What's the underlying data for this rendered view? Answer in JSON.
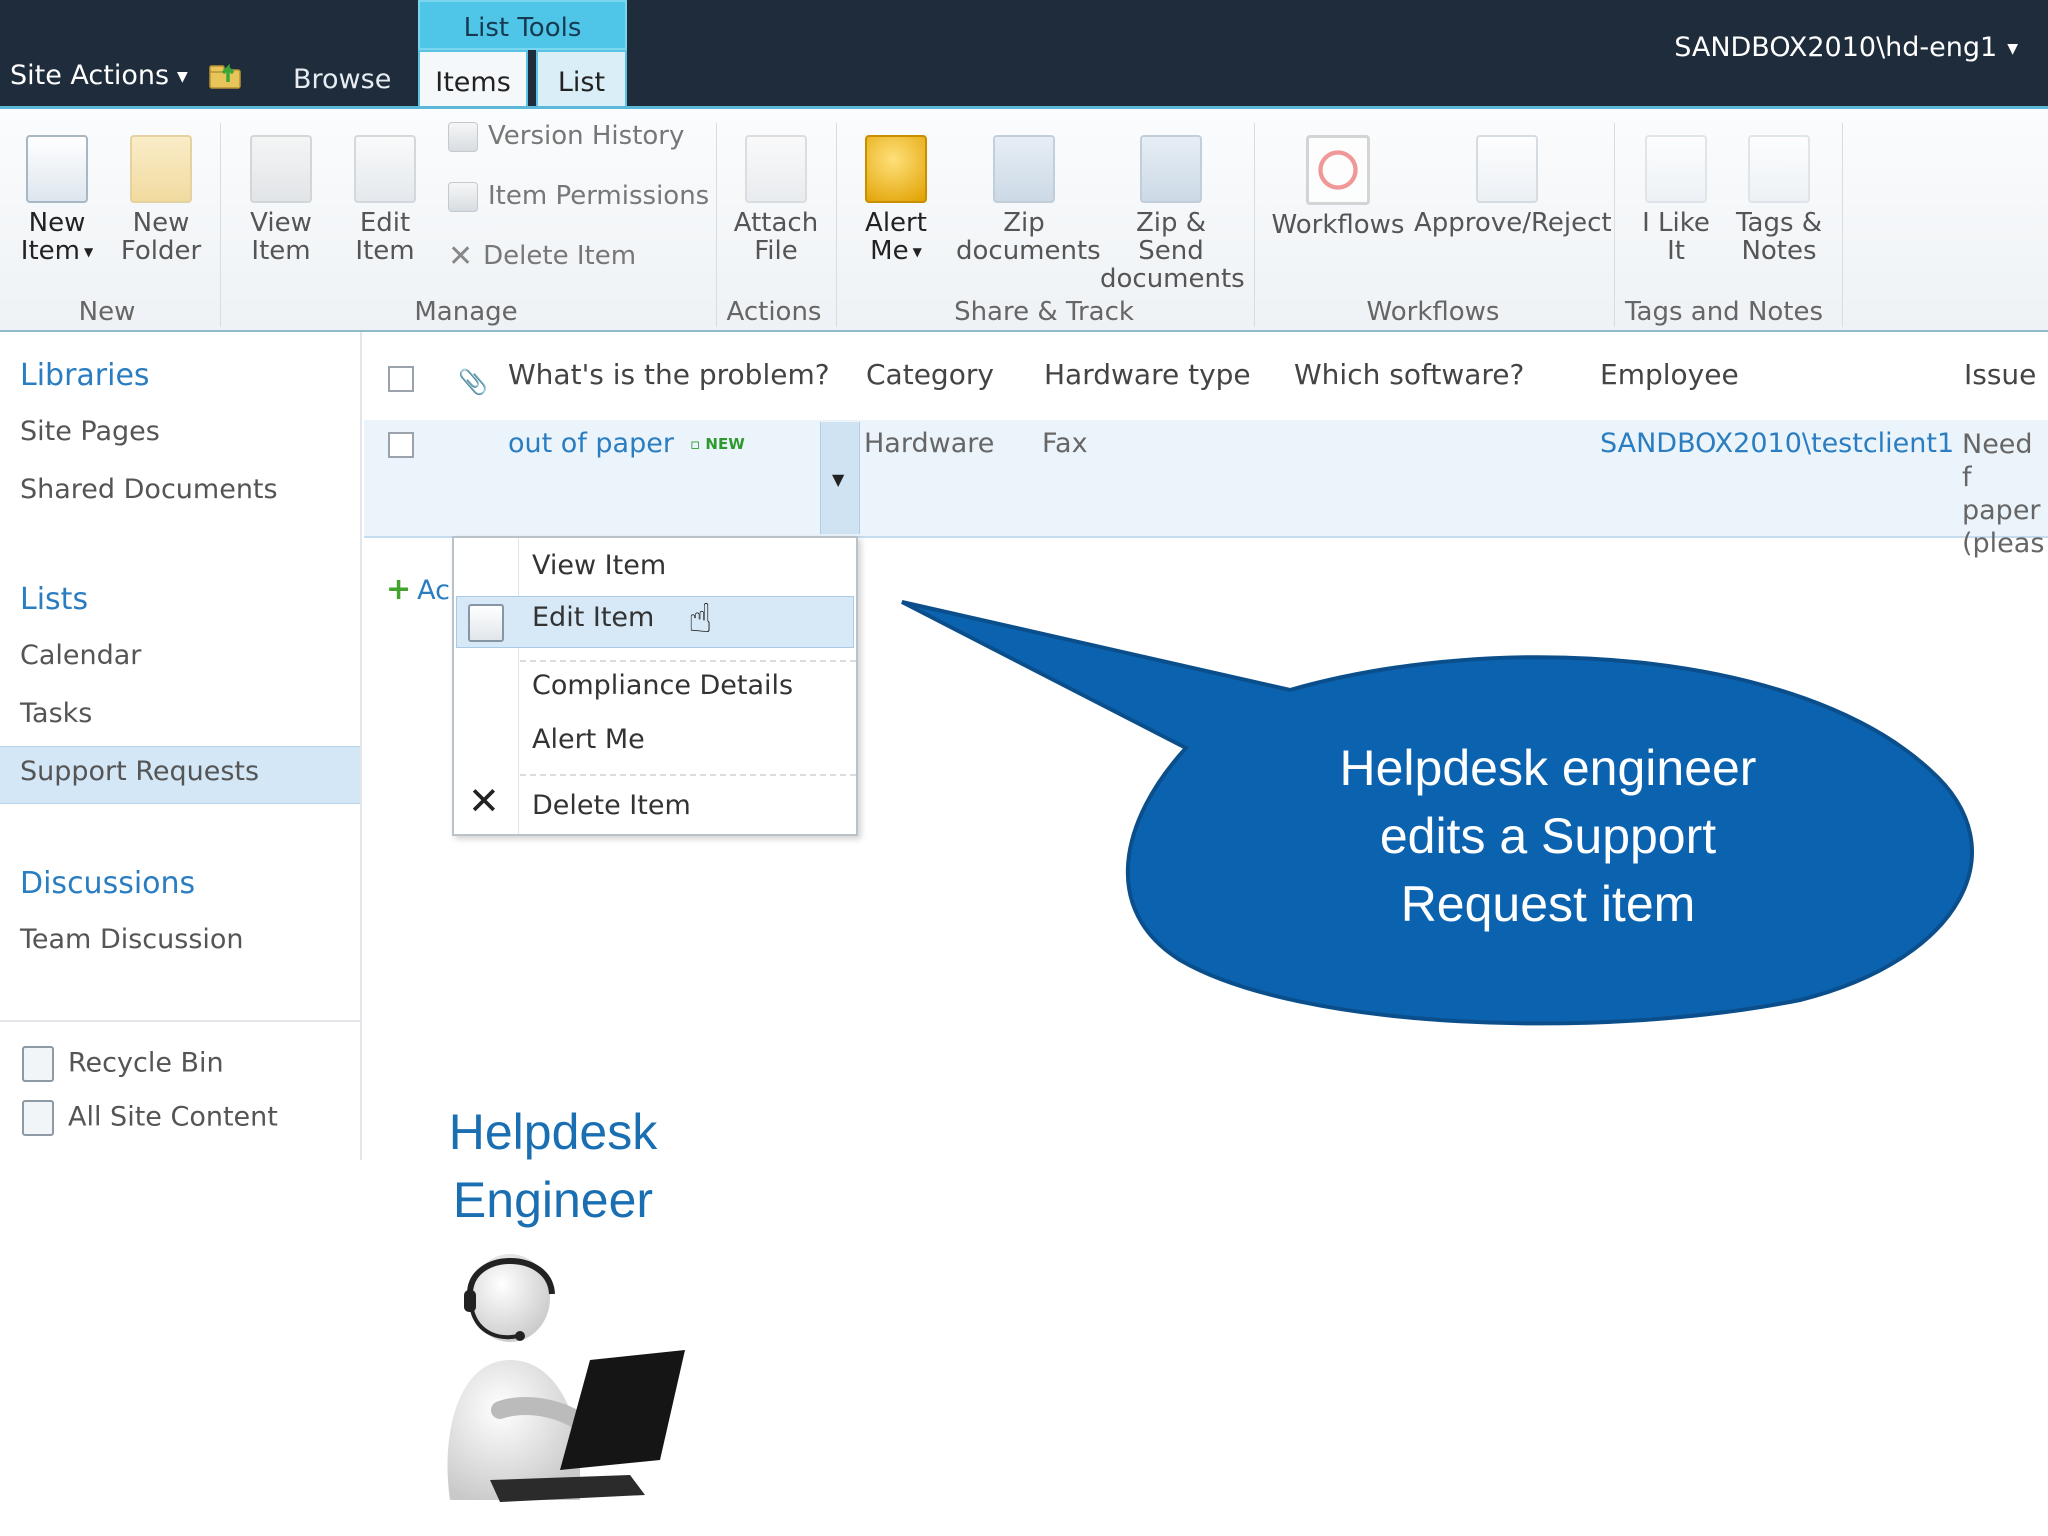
{
  "header": {
    "site_actions": "Site Actions",
    "tab_browse": "Browse",
    "list_tools": "List Tools",
    "tab_items": "Items",
    "tab_list": "List",
    "user": "SANDBOX2010\\hd-eng1"
  },
  "ribbon": {
    "new_item": [
      "New",
      "Item"
    ],
    "new_folder": [
      "New",
      "Folder"
    ],
    "view_item": [
      "View",
      "Item"
    ],
    "edit_item": [
      "Edit",
      "Item"
    ],
    "version_history": "Version History",
    "item_permissions": "Item Permissions",
    "delete_item": "Delete Item",
    "attach_file": [
      "Attach",
      "File"
    ],
    "alert_me": [
      "Alert",
      "Me"
    ],
    "zip_documents": [
      "Zip",
      "documents"
    ],
    "zip_send": [
      "Zip & Send",
      "documents"
    ],
    "workflows": "Workflows",
    "approve_reject": "Approve/Reject",
    "i_like_it": [
      "I Like",
      "It"
    ],
    "tags_notes": [
      "Tags &",
      "Notes"
    ],
    "groups": {
      "new": "New",
      "manage": "Manage",
      "actions": "Actions",
      "share_track": "Share & Track",
      "workflows": "Workflows",
      "tags_notes": "Tags and Notes"
    }
  },
  "leftnav": {
    "libraries": "Libraries",
    "site_pages": "Site Pages",
    "shared_documents": "Shared Documents",
    "lists": "Lists",
    "calendar": "Calendar",
    "tasks": "Tasks",
    "support_requests": "Support Requests",
    "discussions": "Discussions",
    "team_discussion": "Team Discussion",
    "recycle_bin": "Recycle Bin",
    "all_site_content": "All Site Content"
  },
  "list": {
    "columns": [
      "What's is the problem?",
      "Category",
      "Hardware type",
      "Which software?",
      "Employee",
      "Issue"
    ],
    "row": {
      "title": "out of paper",
      "new_badge": "NEW",
      "category": "Hardware",
      "hardware_type": "Fax",
      "software": "",
      "employee": "SANDBOX2010\\testclient1",
      "issue_lines": [
        "Need f",
        "paper",
        "(pleas"
      ]
    },
    "add_new": "Ac"
  },
  "context_menu": {
    "view_item": "View Item",
    "edit_item": "Edit Item",
    "compliance_details": "Compliance Details",
    "alert_me": "Alert Me",
    "delete_item": "Delete Item"
  },
  "callout": {
    "lines": [
      "Helpdesk engineer",
      "edits a Support",
      "Request item"
    ],
    "color": "#0b63b0"
  },
  "engineer_label": [
    "Helpdesk",
    "Engineer"
  ],
  "colors": {
    "topbar": "#1f2c3b",
    "link": "#2a7dc0",
    "contextual_tab": "#4fc6e8"
  }
}
